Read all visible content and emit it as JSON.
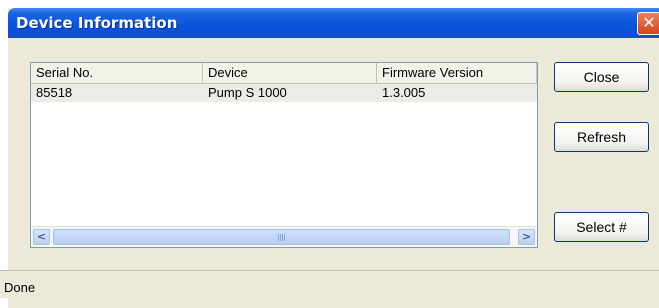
{
  "window": {
    "title": "Device Information",
    "close_glyph": "✕",
    "close_color": "#d2451b"
  },
  "list": {
    "columns": [
      "Serial No.",
      "Device",
      "Firmware Version"
    ],
    "rows": [
      {
        "serial": "85518",
        "device": "Pump S 1000",
        "firmware": "1.3.005"
      }
    ],
    "scroll_left_glyph": "<",
    "scroll_right_glyph": ">"
  },
  "buttons": {
    "close": "Close",
    "refresh": "Refresh",
    "select": "Select #"
  },
  "status": {
    "text": "Done"
  }
}
